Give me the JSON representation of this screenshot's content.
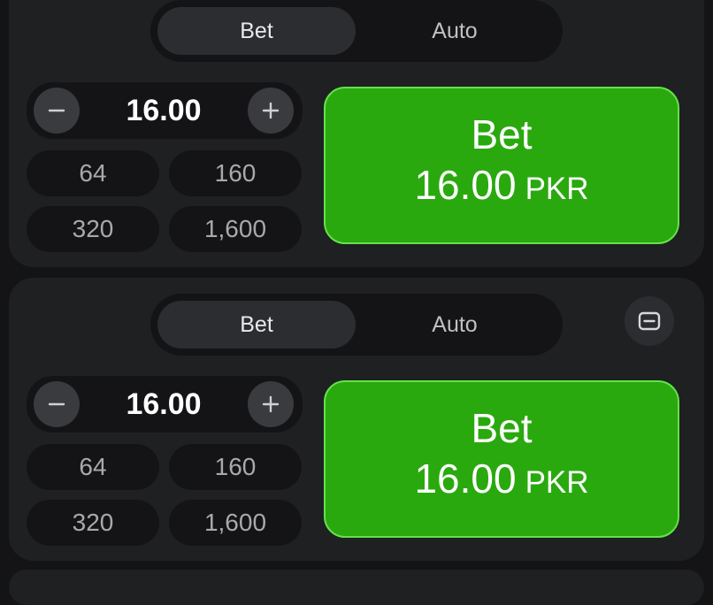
{
  "colors": {
    "background": "#141416",
    "panel": "#1f2022",
    "accent_green": "#2aa90f",
    "accent_green_border": "#64e24a"
  },
  "panels": [
    {
      "tabs": [
        {
          "label": "Bet",
          "active": true
        },
        {
          "label": "Auto",
          "active": false
        }
      ],
      "stake": "16.00",
      "quick_amounts": [
        "64",
        "160",
        "320",
        "1,600"
      ],
      "bet_button": {
        "label": "Bet",
        "amount": "16.00",
        "currency": "PKR"
      },
      "icons": {
        "decrease": "minus-icon",
        "increase": "plus-icon"
      }
    },
    {
      "tabs": [
        {
          "label": "Bet",
          "active": true
        },
        {
          "label": "Auto",
          "active": false
        }
      ],
      "stake": "16.00",
      "quick_amounts": [
        "64",
        "160",
        "320",
        "1,600"
      ],
      "bet_button": {
        "label": "Bet",
        "amount": "16.00",
        "currency": "PKR"
      },
      "icons": {
        "decrease": "minus-icon",
        "increase": "plus-icon",
        "collapse": "collapse-panel-icon"
      }
    }
  ]
}
